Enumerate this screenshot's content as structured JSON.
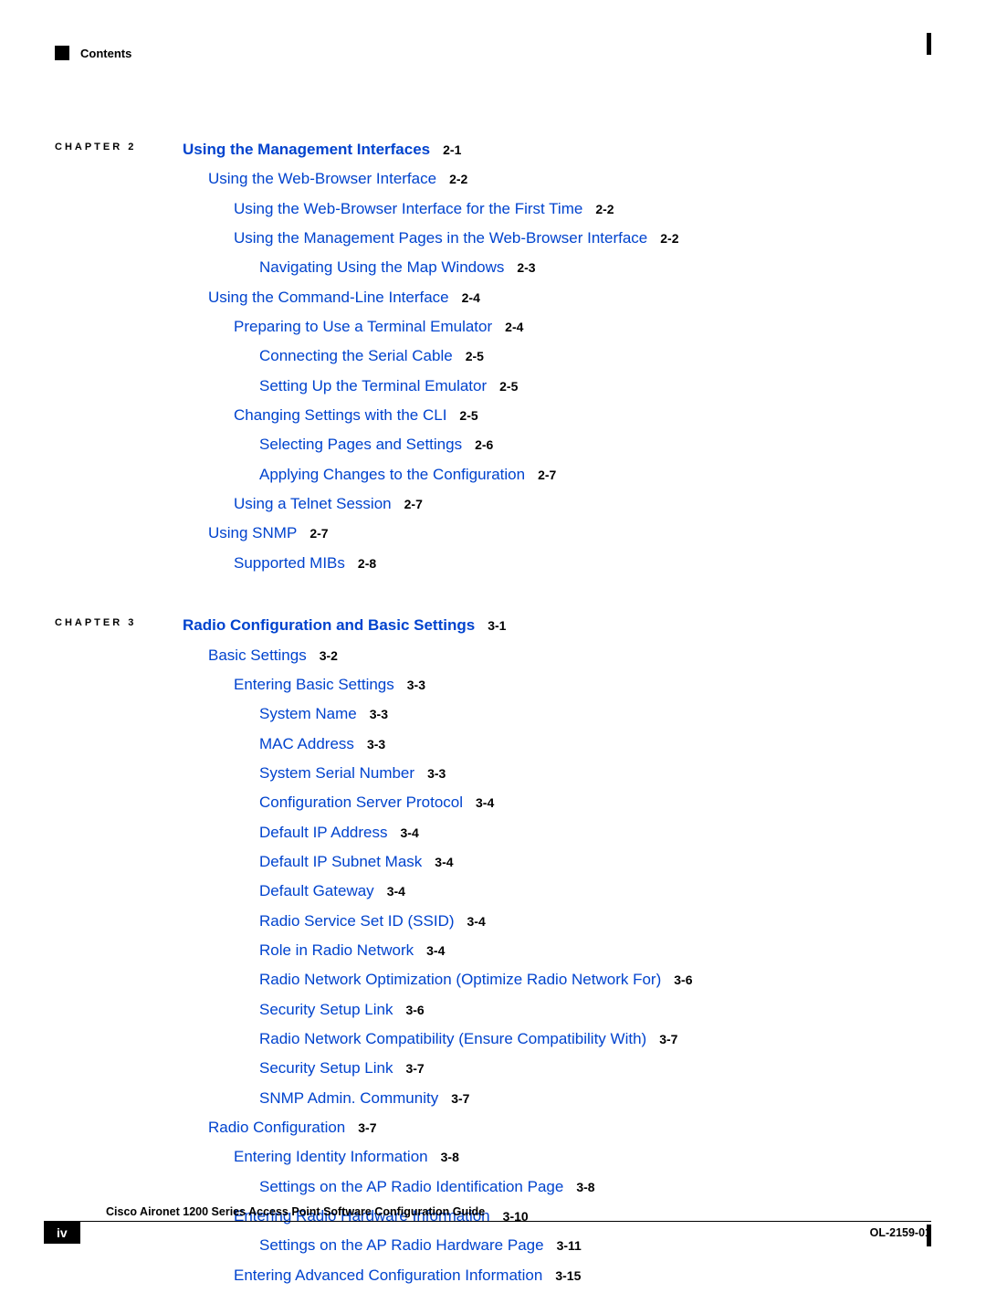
{
  "header": "Contents",
  "chapters": [
    {
      "label": "CHAPTER 2",
      "title": "Using the Management Interfaces",
      "title_page": "2-1",
      "entries": [
        {
          "level": 1,
          "text": "Using the Web-Browser Interface",
          "page": "2-2"
        },
        {
          "level": 2,
          "text": "Using the Web-Browser Interface for the First Time",
          "page": "2-2"
        },
        {
          "level": 2,
          "text": "Using the Management Pages in the Web-Browser Interface",
          "page": "2-2"
        },
        {
          "level": 3,
          "text": "Navigating Using the Map Windows",
          "page": "2-3"
        },
        {
          "level": 1,
          "text": "Using the Command-Line Interface",
          "page": "2-4"
        },
        {
          "level": 2,
          "text": "Preparing to Use a Terminal Emulator",
          "page": "2-4"
        },
        {
          "level": 3,
          "text": "Connecting the Serial Cable",
          "page": "2-5"
        },
        {
          "level": 3,
          "text": "Setting Up the Terminal Emulator",
          "page": "2-5"
        },
        {
          "level": 2,
          "text": "Changing Settings with the CLI",
          "page": "2-5"
        },
        {
          "level": 3,
          "text": "Selecting Pages and Settings",
          "page": "2-6"
        },
        {
          "level": 3,
          "text": "Applying Changes to the Configuration",
          "page": "2-7"
        },
        {
          "level": 2,
          "text": "Using a Telnet Session",
          "page": "2-7"
        },
        {
          "level": 1,
          "text": "Using SNMP",
          "page": "2-7"
        },
        {
          "level": 2,
          "text": "Supported MIBs",
          "page": "2-8"
        }
      ]
    },
    {
      "label": "CHAPTER 3",
      "title": "Radio Configuration and Basic Settings",
      "title_page": "3-1",
      "entries": [
        {
          "level": 1,
          "text": "Basic Settings",
          "page": "3-2"
        },
        {
          "level": 2,
          "text": "Entering Basic Settings",
          "page": "3-3"
        },
        {
          "level": 3,
          "text": "System Name",
          "page": "3-3"
        },
        {
          "level": 3,
          "text": "MAC Address",
          "page": "3-3"
        },
        {
          "level": 3,
          "text": "System Serial Number",
          "page": "3-3"
        },
        {
          "level": 3,
          "text": "Configuration Server Protocol",
          "page": "3-4"
        },
        {
          "level": 3,
          "text": "Default IP Address",
          "page": "3-4"
        },
        {
          "level": 3,
          "text": "Default IP Subnet Mask",
          "page": "3-4"
        },
        {
          "level": 3,
          "text": "Default Gateway",
          "page": "3-4"
        },
        {
          "level": 3,
          "text": "Radio Service Set ID (SSID)",
          "page": "3-4"
        },
        {
          "level": 3,
          "text": "Role in Radio Network",
          "page": "3-4"
        },
        {
          "level": 3,
          "text": "Radio Network Optimization (Optimize Radio Network For)",
          "page": "3-6"
        },
        {
          "level": 3,
          "text": "Security Setup Link",
          "page": "3-6"
        },
        {
          "level": 3,
          "text": "Radio Network Compatibility (Ensure Compatibility With)",
          "page": "3-7"
        },
        {
          "level": 3,
          "text": "Security Setup Link",
          "page": "3-7"
        },
        {
          "level": 3,
          "text": "SNMP Admin. Community",
          "page": "3-7"
        },
        {
          "level": 1,
          "text": "Radio Configuration",
          "page": "3-7"
        },
        {
          "level": 2,
          "text": "Entering Identity Information",
          "page": "3-8"
        },
        {
          "level": 3,
          "text": "Settings on the AP Radio Identification Page",
          "page": "3-8"
        },
        {
          "level": 2,
          "text": "Entering Radio Hardware Information",
          "page": "3-10"
        },
        {
          "level": 3,
          "text": "Settings on the AP Radio Hardware Page",
          "page": "3-11"
        },
        {
          "level": 2,
          "text": "Entering Advanced Configuration Information",
          "page": "3-15"
        }
      ]
    }
  ],
  "footer": {
    "title": "Cisco Aironet 1200 Series Access Point Software Configuration Guide",
    "page_num": "iv",
    "doc_id": "OL-2159-01"
  }
}
